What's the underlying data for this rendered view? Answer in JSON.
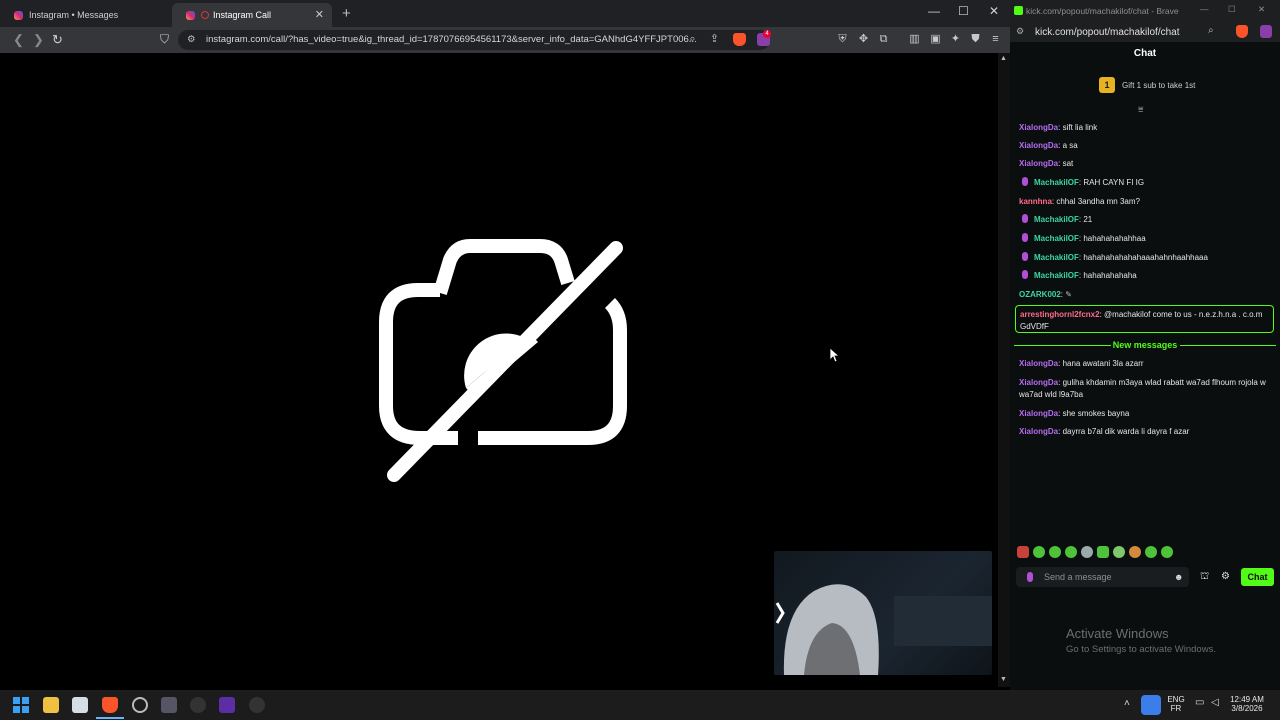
{
  "left_browser": {
    "tabs": [
      {
        "title": "Instagram • Messages"
      },
      {
        "title": "Instagram Call"
      }
    ],
    "new_tab_symbol": "+",
    "address": "instagram.com/call/?has_video=true&ig_thread_id=17870766954561173&server_info_data=GANhdG4YFFJPT006...",
    "brave_notification_count": "4"
  },
  "video": {
    "state_icon": "camera-off-icon"
  },
  "popout": {
    "window_title": "kick.com/popout/machakilof/chat - Brave",
    "address": "kick.com/popout/machakilof/chat",
    "chat_header": "Chat",
    "gift_badge": "1",
    "gift_text": "Gift 1 sub to take 1st",
    "messages": [
      {
        "user": "XialongDa",
        "text": "sift lia link"
      },
      {
        "user": "XialongDa",
        "text": "a sa"
      },
      {
        "user": "XialongDa",
        "text": "sat"
      },
      {
        "user": "MachakilOF",
        "text": "RAH CAYN FI IG"
      },
      {
        "user": "kannhna",
        "text": "chhal 3andha mn 3am?"
      },
      {
        "user": "MachakilOF",
        "text": "21"
      },
      {
        "user": "MachakilOF",
        "text": "hahahahahahhaa"
      },
      {
        "user": "MachakilOF",
        "text": "hahahahahahahaaahahnhaahhaaa"
      },
      {
        "user": "MachakilOF",
        "text": "hahahahahaha"
      },
      {
        "user": "OZARK002",
        "text": ""
      }
    ],
    "highlighted": {
      "user": "arrestinghornl2fcnx2",
      "text": "@machakilof come to us - n.e.z.h.n.a . c.o.m GdVDfF"
    },
    "new_messages_label": "New messages",
    "new_msgs": [
      {
        "user": "XialongDa",
        "text": "hana awatani 3la azarr"
      },
      {
        "user": "XialongDa",
        "text": "guliha khdamin m3aya wlad rabatt wa7ad flhoum rojola w wa7ad wld l9a7ba"
      },
      {
        "user": "XialongDa",
        "text": "she smokes bayna"
      },
      {
        "user": "XialongDa",
        "text": "dayrra b7al dik warda li dayra f azar"
      }
    ],
    "send_placeholder": "Send a message",
    "chat_button": "Chat",
    "activate_title": "Activate Windows",
    "activate_sub": "Go to Settings to activate Windows."
  },
  "taskbar": {
    "lang_top": "ENG",
    "lang_bottom": "FR",
    "time": "12:49 AM",
    "date": "3/8/2026"
  },
  "colors": {
    "kick_green": "#53fc18",
    "purple_user": "#b56cf0",
    "teal_user": "#3bd6a1",
    "pink_user": "#ff6b8a"
  }
}
